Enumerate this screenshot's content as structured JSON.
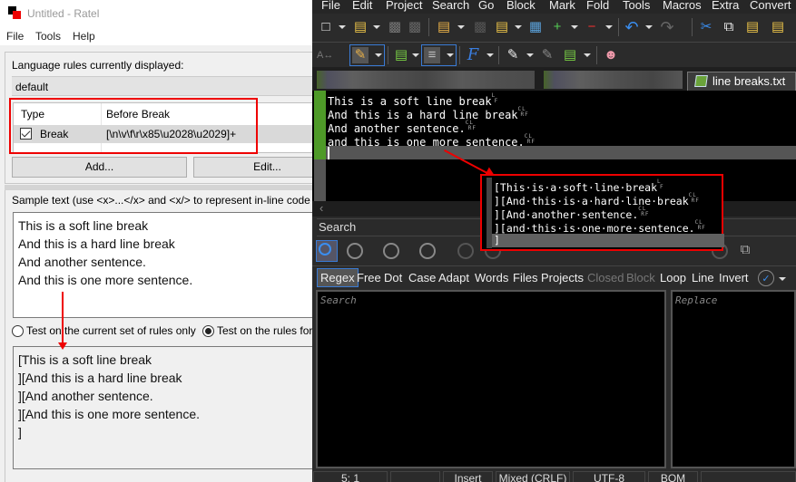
{
  "ratel": {
    "title": "Untitled - Ratel",
    "menu": [
      "File",
      "Tools",
      "Help"
    ],
    "rules_label": "Language rules currently displayed:",
    "language": "default",
    "table": {
      "headers": [
        "Type",
        "Before Break"
      ],
      "rows": [
        {
          "checked": true,
          "type": "Break",
          "before_break": "[\\n\\v\\f\\r\\x85\\u2028\\u2029]+"
        }
      ]
    },
    "buttons": {
      "add": "Add...",
      "edit": "Edit..."
    },
    "sample_label": "Sample text (use <x>...</x> and <x/> to represent in-line code",
    "sample_lines": [
      "This is a soft line break",
      "And this is a hard line break",
      "And another sentence.",
      "And this is one more sentence."
    ],
    "radios": [
      {
        "label": "Test on the current set of rules only",
        "selected": false
      },
      {
        "label": "Test on the rules for",
        "selected": true
      }
    ],
    "result_lines": [
      "[This is a soft line break",
      "][And this is a hard line break",
      "][And another sentence.",
      "][And this is one more sentence.",
      "]"
    ]
  },
  "editor": {
    "menu": [
      "File",
      "Edit",
      "Project",
      "Search",
      "Go",
      "Block",
      "Mark",
      "Fold",
      "Tools",
      "Macros",
      "Extra",
      "Convert"
    ],
    "active_tab": "line breaks.txt",
    "lines": [
      {
        "text": "This is a soft line break",
        "eol_top": "L",
        "eol_bot": "F"
      },
      {
        "text": "And this is a hard line break",
        "eol_top": "CL",
        "eol_bot": "RF"
      },
      {
        "text": "And another sentence.",
        "eol_top": "CL",
        "eol_bot": "RF"
      },
      {
        "text": "and this is one more sentence.",
        "eol_top": "CL",
        "eol_bot": "RF"
      }
    ],
    "popup_lines": [
      {
        "text": "[This·is·a·soft·line·break",
        "eol_top": "L",
        "eol_bot": "F"
      },
      {
        "text": "][And·this·is·a·hard·line·break",
        "eol_top": "CL",
        "eol_bot": "RF"
      },
      {
        "text": "][And·another·sentence.",
        "eol_top": "CL",
        "eol_bot": "RF"
      },
      {
        "text": "][and·this·is·one·more·sentence.",
        "eol_top": "CL",
        "eol_bot": "RF"
      },
      {
        "text": "]",
        "eol_top": "",
        "eol_bot": ""
      }
    ],
    "search_label": "Search",
    "options": [
      {
        "label": "Regex",
        "state": "selected"
      },
      {
        "label": "Free",
        "state": "on"
      },
      {
        "label": "Dot",
        "state": "on"
      },
      {
        "label": "Case",
        "state": "on"
      },
      {
        "label": "Adapt",
        "state": "on"
      },
      {
        "label": "Words",
        "state": "on"
      },
      {
        "label": "Files",
        "state": "on"
      },
      {
        "label": "Projects",
        "state": "on"
      },
      {
        "label": "Closed",
        "state": "disabled"
      },
      {
        "label": "Block",
        "state": "disabled"
      },
      {
        "label": "Loop",
        "state": "on"
      },
      {
        "label": "Line",
        "state": "on"
      },
      {
        "label": "Invert",
        "state": "on"
      }
    ],
    "search_placeholder": "Search",
    "replace_placeholder": "Replace",
    "status": [
      "5: 1",
      "",
      "Insert",
      "Mixed (CRLF)",
      "UTF-8",
      "BOM",
      ""
    ]
  }
}
